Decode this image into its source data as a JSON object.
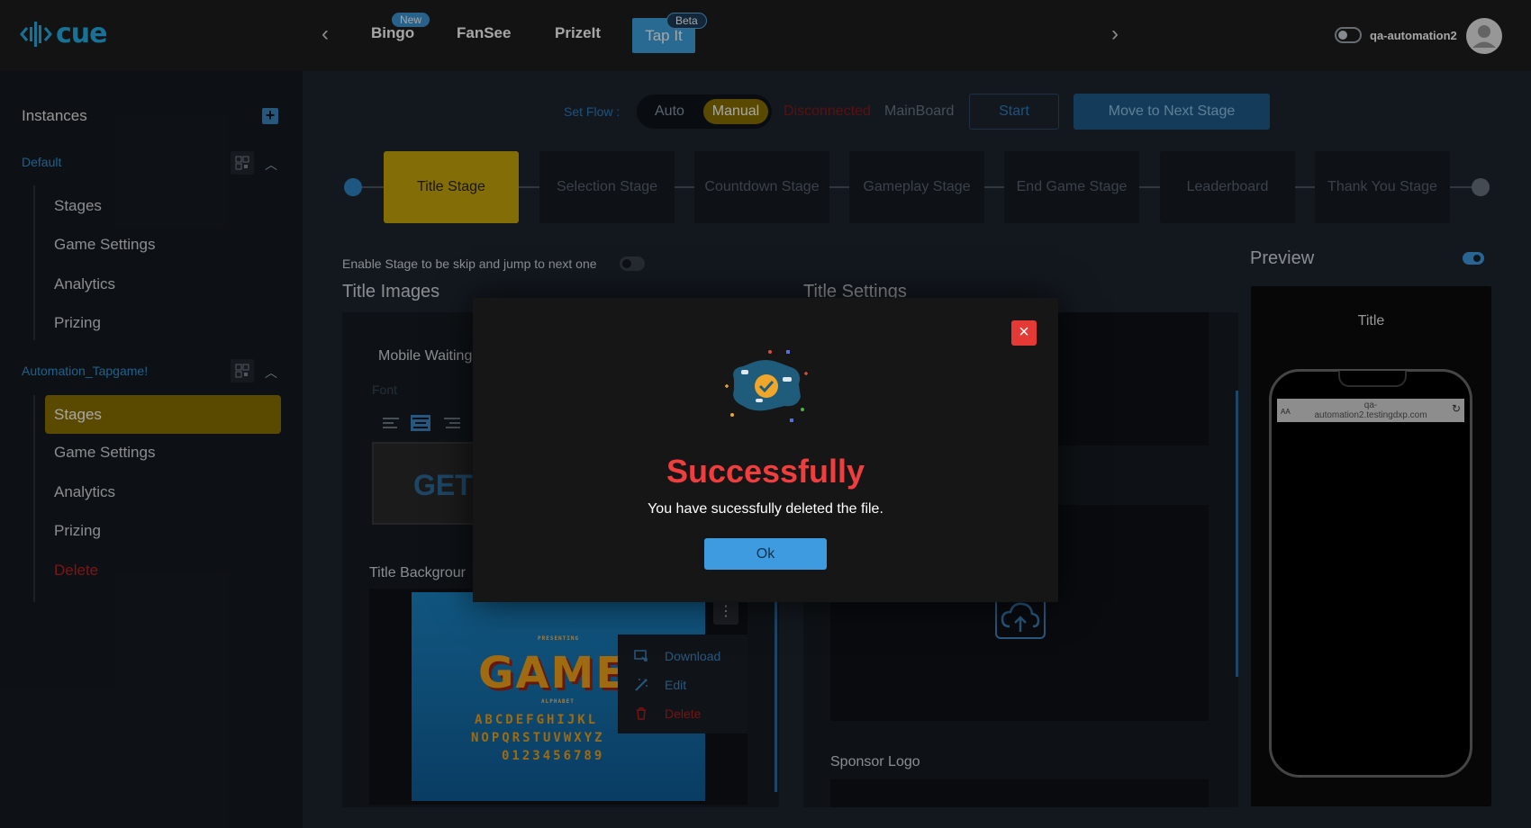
{
  "app": {
    "logo_text": "cue"
  },
  "games": [
    {
      "label": "Bingo",
      "badge": "New"
    },
    {
      "label": "FanSee",
      "badge": ""
    },
    {
      "label": "PrizeIt",
      "badge": ""
    },
    {
      "label": "Tap It",
      "badge": "Beta",
      "active": true
    }
  ],
  "user": {
    "name": "qa-automation2"
  },
  "sidebar": {
    "title": "Instances",
    "groups": [
      {
        "name": "Default",
        "items": [
          "Stages",
          "Game Settings",
          "Analytics",
          "Prizing"
        ]
      },
      {
        "name": "Automation_Tapgame!",
        "items": [
          "Stages",
          "Game Settings",
          "Analytics",
          "Prizing"
        ],
        "active_item": "Stages",
        "delete_label": "Delete"
      }
    ]
  },
  "flow": {
    "label": "Set Flow :",
    "auto": "Auto",
    "manual": "Manual",
    "status": "Disconnected",
    "board": "MainBoard",
    "start": "Start",
    "next": "Move to Next Stage"
  },
  "stages": [
    "Title Stage",
    "Selection Stage",
    "Countdown Stage",
    "Gameplay Stage",
    "End Game Stage",
    "Leaderboard",
    "Thank You Stage"
  ],
  "active_stage": "Title Stage",
  "main": {
    "skip_label": "Enable Stage to be skip and jump to next one",
    "title_images": "Title Images",
    "title_settings": "Title Settings",
    "preview": "Preview",
    "mobile_waiting": "Mobile Waiting",
    "font_placeholder": "Font",
    "get_text": "GET",
    "title_background": "Title Backgrour",
    "sponsor_logo": "Sponsor Logo",
    "games_image": {
      "presenting": "PRESENTING",
      "word": "GAMES",
      "alphabet": "ALPHABET",
      "line1": "ABCDEFGHIJKL",
      "line2": "NOPQRSTUVWXYZ",
      "line3": "0123456789"
    },
    "context_menu": [
      "Download",
      "Edit",
      "Delete"
    ]
  },
  "phone_preview": {
    "title": "Title",
    "url_line1": "qa-",
    "url_line2": "automation2.testingdxp.com",
    "aa": "AA"
  },
  "modal": {
    "title": "Successfully",
    "message": "You have sucessfully deleted the file.",
    "ok": "Ok",
    "close": "×"
  },
  "colors": {
    "accent": "#3ea3df",
    "active_gold": "#c8a80a",
    "sidebar_active": "#8a7200",
    "danger": "#f03e3e"
  }
}
